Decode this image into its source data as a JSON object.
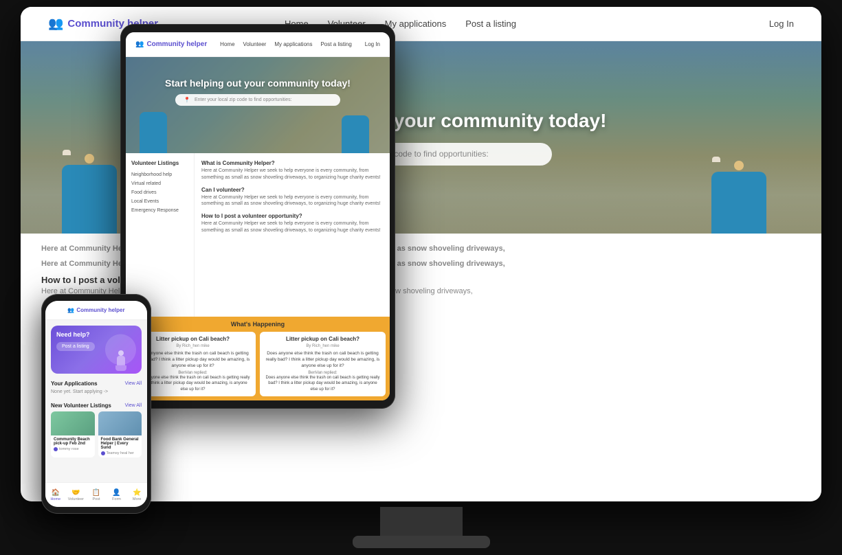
{
  "app": {
    "name": "Community helper",
    "logo_icon": "👥"
  },
  "nav": {
    "links": [
      "Home",
      "Volunteer",
      "My applications",
      "Post a listing"
    ],
    "login": "Log In"
  },
  "hero": {
    "title": "Start helping out your community today!",
    "search_placeholder": "Enter your local zip code to find opportunities:"
  },
  "faq": {
    "items": [
      {
        "title": "What is Community Helper?",
        "text": "Here at Community Helper we seek to help everyone is every community, from something as small as snow shoveling driveways, to organizing huge charity events!"
      },
      {
        "title": "Can I volunteer?",
        "text": "Here at Community Helper we seek to help everyone is every community, from something as small as snow shoveling driveways, to organizing huge charity events!"
      },
      {
        "title": "How to I post a volunteer opportunity?",
        "text": "Here at Community Helper we seek to help everyone is every community, from something as small as snow shoveling driveways, to organizing huge charity events!"
      }
    ]
  },
  "sidebar": {
    "title": "Volunteer Listings",
    "items": [
      "Neighborhood help",
      "Virtual related",
      "Food drives",
      "Local Events",
      "Emergency Response"
    ]
  },
  "phone": {
    "hero_text": "Need help?",
    "hero_sub": "",
    "hero_btn": "Post a listing",
    "your_applications": {
      "title": "Your Applications",
      "view_all": "View All",
      "empty": "None yet. Start applying ->"
    },
    "new_listings": {
      "title": "New Volunteer Listings",
      "view_all": "View All",
      "items": [
        {
          "title": "Community Beach pick-up Feb 2nd",
          "org": "tommy rose"
        },
        {
          "title": "Food Bank General Helper | Every Sund",
          "org": "Teamsy heal her"
        }
      ]
    },
    "bottom_nav": [
      {
        "icon": "🏠",
        "label": "Home",
        "active": true
      },
      {
        "icon": "🤝",
        "label": "Volunteer"
      },
      {
        "icon": "📋",
        "label": "Post"
      },
      {
        "icon": "👤",
        "label": "Form"
      },
      {
        "icon": "⭐",
        "label": "More"
      }
    ]
  },
  "whats_happening": {
    "title": "What's Happening",
    "cards": [
      {
        "title": "Litter pickup on Cali beach?",
        "author": "By Rich_hen mike",
        "text": "Does anyone else think the trash on cali beach is getting really bad? I think a litter pickup day would be amazing, is anyone else up for it?",
        "reply_author": "BenVan replied:",
        "reply_text": "Does anyone else think the trash on cali beach is getting really bad? I think a litter pickup day would be amazing, is anyone else up for it?"
      },
      {
        "title": "Litter pickup on Cali beach?",
        "author": "By Rich_hen mike",
        "text": "Does anyone else think the trash on cali beach is getting really bad? I think a litter pickup day would be amazing, is anyone else up for it?",
        "reply_author": "BenVan replied:",
        "reply_text": "Does anyone else think the trash on cali beach is getting really bad? I think a litter pickup day would be amazing, is anyone else up for it?"
      }
    ]
  }
}
